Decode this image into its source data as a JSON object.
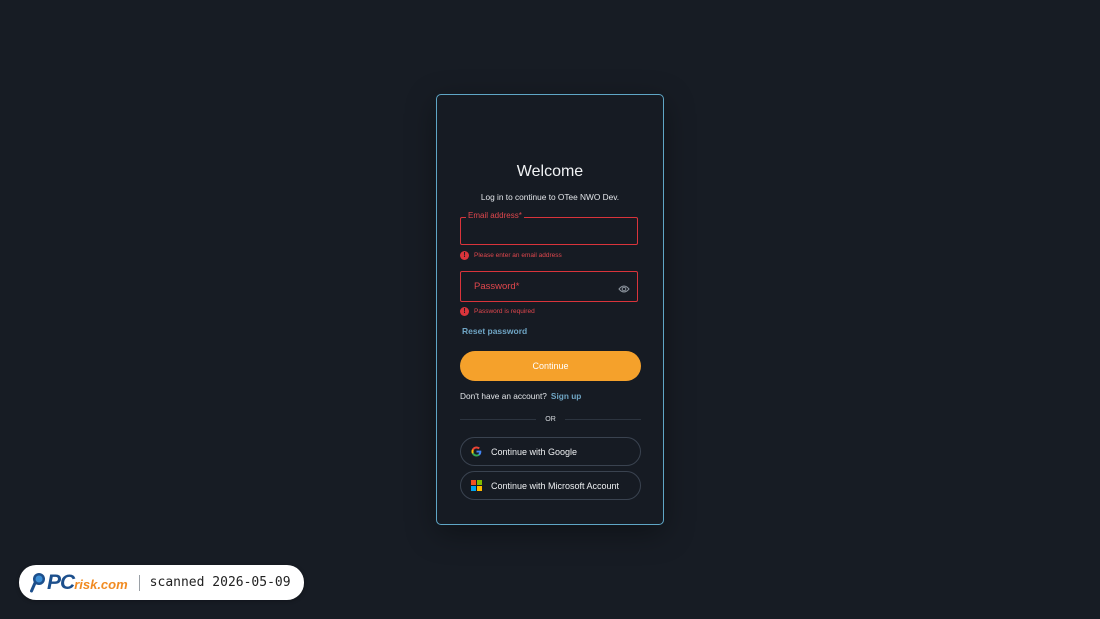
{
  "login": {
    "title": "Welcome",
    "subtitle": "Log in to continue to OTee NWO Dev.",
    "email_label": "Email address*",
    "email_error": "Please enter an email address",
    "password_label": "Password*",
    "password_error": "Password is required",
    "reset_link": "Reset password",
    "continue_label": "Continue",
    "no_account_text": "Don't have an account?",
    "signup_link": "Sign up",
    "divider_text": "OR",
    "google_label": "Continue with Google",
    "microsoft_label": "Continue with Microsoft Account"
  },
  "icons": {
    "password_toggle": "eye-icon",
    "error": "error-icon",
    "google": "google-logo-icon",
    "microsoft": "microsoft-logo-icon"
  },
  "watermark": {
    "logo_text_main": "PC",
    "logo_text_suffix": "risk.com",
    "scan_text": "scanned 2026-05-09"
  },
  "colors": {
    "background": "#171c24",
    "card_border": "#5fa6c6",
    "error": "#d9343b",
    "accent_button": "#f5a12b",
    "link": "#6fa5c4"
  }
}
